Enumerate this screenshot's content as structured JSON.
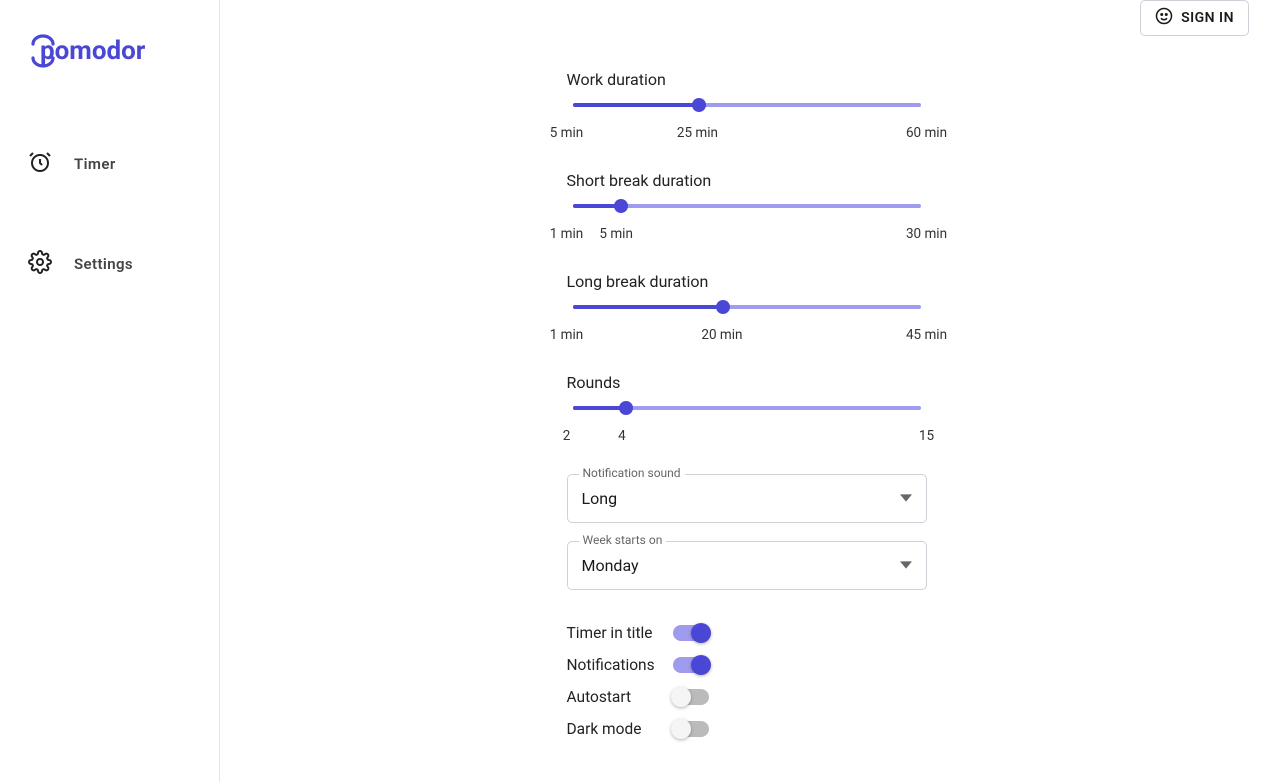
{
  "header": {
    "signin_label": "SIGN IN"
  },
  "logo": {
    "text": "pomodor"
  },
  "nav": {
    "timer_label": "Timer",
    "settings_label": "Settings"
  },
  "settings": {
    "work": {
      "label": "Work duration",
      "min": 5,
      "max": 60,
      "value": 25,
      "min_label": "5 min",
      "value_label": "25 min",
      "max_label": "60 min"
    },
    "short_break": {
      "label": "Short break duration",
      "min": 1,
      "max": 30,
      "value": 5,
      "min_label": "1 min",
      "value_label": "5 min",
      "max_label": "30 min"
    },
    "long_break": {
      "label": "Long break duration",
      "min": 1,
      "max": 45,
      "value": 20,
      "min_label": "1 min",
      "value_label": "20 min",
      "max_label": "45 min"
    },
    "rounds": {
      "label": "Rounds",
      "min": 2,
      "max": 15,
      "value": 4,
      "min_label": "2",
      "value_label": "4",
      "max_label": "15"
    },
    "notification_sound": {
      "label": "Notification sound",
      "value": "Long"
    },
    "week_start": {
      "label": "Week starts on",
      "value": "Monday"
    },
    "toggles": {
      "timer_in_title": {
        "label": "Timer in title",
        "on": true
      },
      "notifications": {
        "label": "Notifications",
        "on": true
      },
      "autostart": {
        "label": "Autostart",
        "on": false
      },
      "dark_mode": {
        "label": "Dark mode",
        "on": false
      }
    }
  }
}
